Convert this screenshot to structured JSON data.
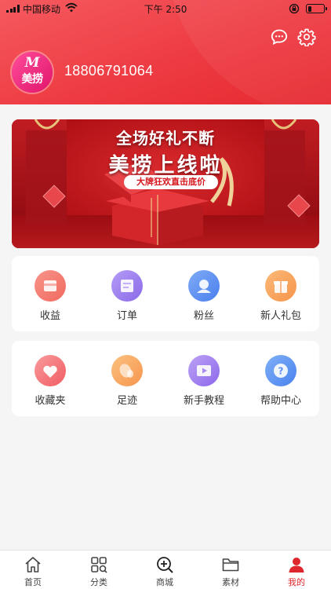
{
  "status_bar": {
    "carrier": "中国移动",
    "time": "下午 2:50",
    "battery_level": 0.2
  },
  "header": {
    "logo_text": "美捞",
    "logo_letter": "M",
    "phone": "18806791064",
    "icons": [
      "message-icon",
      "gear-icon"
    ]
  },
  "banner": {
    "line1": "全场好礼不断",
    "line2": "美捞上线啦",
    "tagline": "大牌狂欢直击底价"
  },
  "menu_row1": [
    {
      "label": "收益",
      "icon": "income-icon",
      "color": "#f4746a"
    },
    {
      "label": "订单",
      "icon": "order-icon",
      "color": "#9b7df0"
    },
    {
      "label": "粉丝",
      "icon": "fans-icon",
      "color": "#5b8ff2"
    },
    {
      "label": "新人礼包",
      "icon": "gift-icon",
      "color": "#f9a25c"
    }
  ],
  "menu_row2": [
    {
      "label": "收藏夹",
      "icon": "favorites-icon",
      "color": "#f6757a"
    },
    {
      "label": "足迹",
      "icon": "footprint-icon",
      "color": "#f9a661"
    },
    {
      "label": "新手教程",
      "icon": "tutorial-icon",
      "color": "#a078ee"
    },
    {
      "label": "帮助中心",
      "icon": "help-icon",
      "color": "#5a94f2"
    }
  ],
  "tabbar": [
    {
      "label": "首页",
      "icon": "home-icon"
    },
    {
      "label": "分类",
      "icon": "category-icon"
    },
    {
      "label": "商城",
      "icon": "mall-icon"
    },
    {
      "label": "素材",
      "icon": "folder-icon"
    },
    {
      "label": "我的",
      "icon": "user-icon",
      "active": true
    }
  ],
  "colors": {
    "brand_red": "#ee3b43",
    "active_tab": "#e0262d"
  }
}
